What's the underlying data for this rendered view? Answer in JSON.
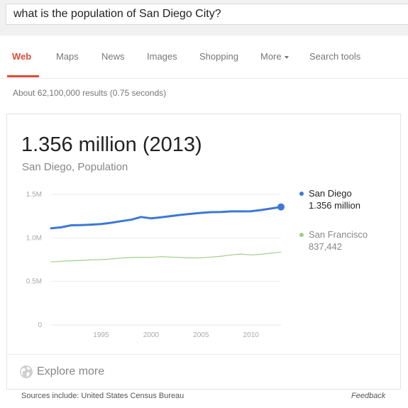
{
  "search": {
    "query": "what is the population of San Diego City?"
  },
  "nav": {
    "tabs": [
      {
        "label": "Web",
        "active": true
      },
      {
        "label": "Maps"
      },
      {
        "label": "News"
      },
      {
        "label": "Images"
      },
      {
        "label": "Shopping"
      },
      {
        "label": "More"
      },
      {
        "label": "Search tools"
      }
    ]
  },
  "results_stats": "About 62,100,000 results (0.75 seconds)",
  "answer": {
    "headline": "1.356 million (2013)",
    "subtitle": "San Diego, Population",
    "explore_label": "Explore more"
  },
  "chart_data": {
    "type": "line",
    "x": [
      1990,
      1991,
      1992,
      1993,
      1994,
      1995,
      1996,
      1997,
      1998,
      1999,
      2000,
      2001,
      2002,
      2003,
      2004,
      2005,
      2006,
      2007,
      2008,
      2009,
      2010,
      2011,
      2012,
      2013
    ],
    "series": [
      {
        "name": "San Diego",
        "value_label": "1.356 million",
        "color": "#3c78d8",
        "values": [
          1.111,
          1.122,
          1.145,
          1.148,
          1.153,
          1.16,
          1.174,
          1.193,
          1.209,
          1.241,
          1.225,
          1.237,
          1.251,
          1.266,
          1.277,
          1.288,
          1.296,
          1.299,
          1.305,
          1.305,
          1.307,
          1.321,
          1.338,
          1.356
        ]
      },
      {
        "name": "San Francisco",
        "value_label": "837,442",
        "color": "#9ecf8a",
        "values": [
          0.724,
          0.731,
          0.738,
          0.742,
          0.748,
          0.75,
          0.758,
          0.769,
          0.775,
          0.778,
          0.777,
          0.785,
          0.78,
          0.775,
          0.77,
          0.772,
          0.78,
          0.79,
          0.805,
          0.815,
          0.805,
          0.812,
          0.826,
          0.837
        ]
      }
    ],
    "yticks": [
      {
        "value": 0,
        "label": "0"
      },
      {
        "value": 0.5,
        "label": "0.5M"
      },
      {
        "value": 1.0,
        "label": "1.0M"
      },
      {
        "value": 1.5,
        "label": "1.5M"
      }
    ],
    "xticks": [
      1995,
      2000,
      2005,
      2010
    ],
    "ylim": [
      0,
      1.5
    ],
    "xlim": [
      1990,
      2013
    ],
    "grid": true,
    "legend": "right"
  },
  "footer": {
    "sources": "Sources include: United States Census Bureau",
    "feedback": "Feedback"
  }
}
